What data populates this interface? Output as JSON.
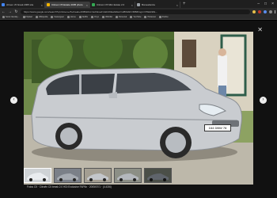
{
  "browser": {
    "tabs": [
      {
        "label": "citroen c5 break 2005 site"
      },
      {
        "label": "Citroen C5 Estate 2005 photo"
      },
      {
        "label": "Citroën C5 Mk1 Estate 2.0"
      },
      {
        "label": "Bonaudanza"
      }
    ],
    "new_tab_label": "+",
    "address": "https://www.google.com/search?q=citroen+c5+break+2005&tbm=isch&ved=2ahUKEwi&biw=1280&bih=688#imgrc=X5kd2k9L...",
    "bookmarks": [
      "Sonic Identity...",
      "Flipkart",
      "Wikipedia",
      "Fastergear",
      "Home",
      "Netflix",
      "Onyx",
      "Wishlist",
      "Personal",
      "YouTube",
      "Pinterest",
      "Firefox"
    ]
  },
  "viewer": {
    "close_glyph": "✕",
    "prev_glyph": "‹",
    "next_glyph": "›",
    "license_plate": "164 DBW 78",
    "caption": "Fotos C5 · Citroën C5 break 2.0 HDi Exclusive FAP6x · 2005/07/1 · (4.43/6)"
  }
}
